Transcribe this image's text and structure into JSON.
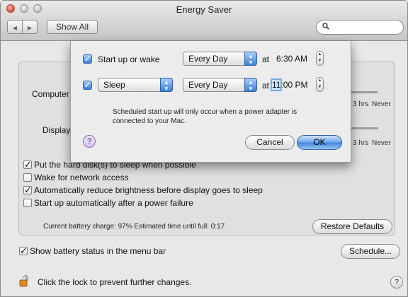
{
  "window": {
    "title": "Energy Saver"
  },
  "toolbar": {
    "back_glyph": "◀",
    "forward_glyph": "▶",
    "show_all_label": "Show All",
    "search_placeholder": ""
  },
  "background": {
    "computer_label": "Computer",
    "display_label": "Display",
    "computer_tick_3hrs": "3 hrs",
    "computer_tick_never": "Never",
    "display_tick_3hrs": "3 hrs",
    "display_tick_never": "Never",
    "options": [
      {
        "label": "Put the hard disk(s) to sleep when possible",
        "checked": true
      },
      {
        "label": "Wake for network access",
        "checked": false
      },
      {
        "label": "Automatically reduce brightness before display goes to sleep",
        "checked": true
      },
      {
        "label": "Start up automatically after a power failure",
        "checked": false
      }
    ],
    "battery_status": "Current battery charge: 97%  Estimated time until full: 0:17",
    "restore_defaults_label": "Restore Defaults",
    "show_battery_label": "Show battery status in the menu bar",
    "show_battery_checked": true,
    "schedule_label": "Schedule...",
    "lock_text": "Click the lock to prevent further changes.",
    "help_glyph": "?"
  },
  "sheet": {
    "row1": {
      "checked": true,
      "label": "Start up or wake",
      "frequency": "Every Day",
      "at_label": "at",
      "time": "6:30 AM"
    },
    "row2": {
      "checked": true,
      "action": "Sleep",
      "frequency": "Every Day",
      "at_label": "at",
      "time_hour": "11",
      "time_rest": ":00 PM"
    },
    "note": "Scheduled start up will only occur when a power adapter is connected to your Mac.",
    "help_glyph": "?",
    "cancel_label": "Cancel",
    "ok_label": "OK"
  },
  "colors": {
    "accent": "#3b7fdc",
    "window_bg": "#e8e8e8"
  }
}
